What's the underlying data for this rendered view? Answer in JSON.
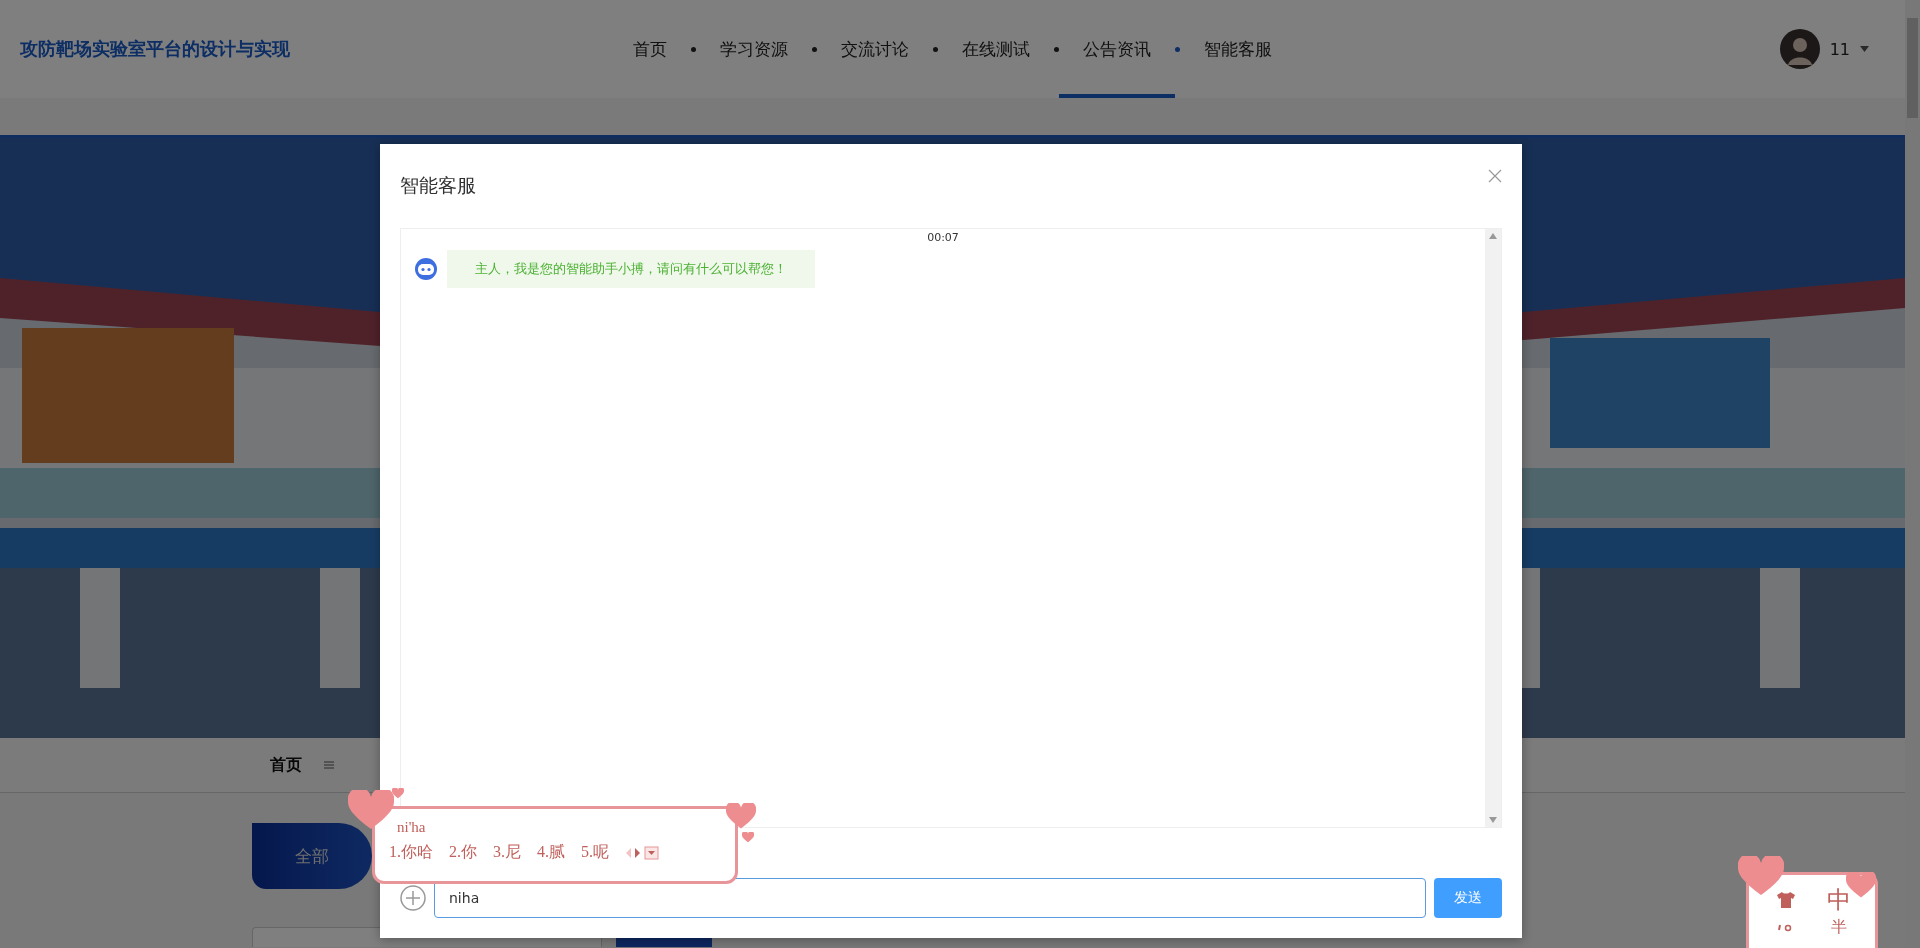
{
  "header": {
    "logo": "攻防靶场实验室平台的设计与实现",
    "nav": [
      {
        "label": "首页",
        "selected": false
      },
      {
        "label": "学习资源",
        "selected": false
      },
      {
        "label": "交流讨论",
        "selected": false
      },
      {
        "label": "在线测试",
        "selected": false
      },
      {
        "label": "公告资讯",
        "selected": true
      },
      {
        "label": "智能客服",
        "selected": false
      }
    ],
    "user": {
      "name": "11"
    }
  },
  "breadcrumb": [
    "首页"
  ],
  "category_tabs": [
    {
      "label": "全部",
      "selected": true
    }
  ],
  "dialog": {
    "title": "智能客服",
    "messages": [
      {
        "time": "00:07",
        "kind": "bot",
        "text": "主人，我是您的智能助手小搏，请问有什么可以帮您！"
      }
    ],
    "input": {
      "value": "niha"
    },
    "send_label": "发送"
  },
  "ime": {
    "composition": "ni'ha",
    "candidates": [
      "1.你哈",
      "2.你",
      "3.尼",
      "4.腻",
      "5.呢"
    ]
  },
  "ime_status": {
    "mode": "中",
    "width": "半"
  }
}
